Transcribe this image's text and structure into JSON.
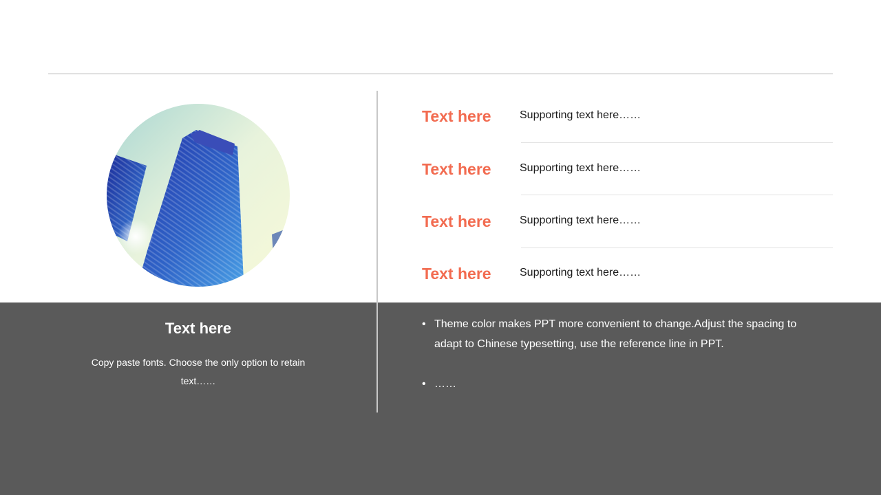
{
  "left_panel": {
    "title": "Text here",
    "description": "Copy paste fonts. Choose the only option to retain text……"
  },
  "rows": [
    {
      "title": "Text here",
      "support": "Supporting text here……"
    },
    {
      "title": "Text here",
      "support": "Supporting text here……"
    },
    {
      "title": "Text here",
      "support": "Supporting text here……"
    },
    {
      "title": "Text here",
      "support": "Supporting text here……"
    }
  ],
  "bullets": [
    {
      "marker": "•",
      "text": "Theme color makes PPT more convenient to change.Adjust the spacing to adapt to Chinese typesetting, use the reference line in PPT."
    },
    {
      "marker": "•",
      "text": "……"
    }
  ],
  "colors": {
    "accent": "#f26b50",
    "dark_band": "#5a5a5a",
    "rule": "#b4b4b4"
  },
  "icons": {
    "photo": "skyscraper-photo"
  }
}
